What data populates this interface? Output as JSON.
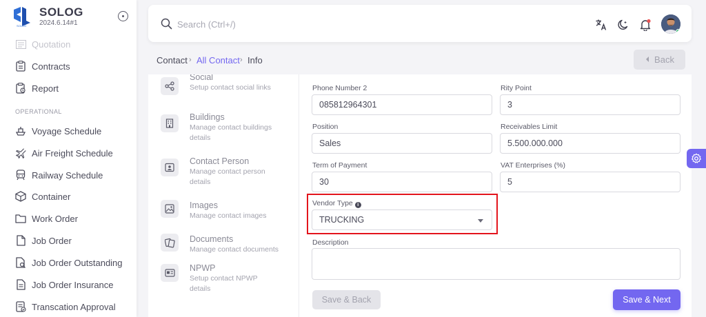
{
  "brand": {
    "name": "SOLOG",
    "version": "2024.6.14#1",
    "logo_text": "SL"
  },
  "sidebar": {
    "section_label": "OPERATIONAL",
    "items": [
      {
        "label": "Quotation",
        "icon": "quotation-icon"
      },
      {
        "label": "Contracts",
        "icon": "contract-icon"
      },
      {
        "label": "Report",
        "icon": "report-icon"
      },
      {
        "label": "Voyage Schedule",
        "icon": "ship-icon"
      },
      {
        "label": "Air Freight Schedule",
        "icon": "plane-icon"
      },
      {
        "label": "Railway Schedule",
        "icon": "train-icon"
      },
      {
        "label": "Container",
        "icon": "container-icon"
      },
      {
        "label": "Work Order",
        "icon": "folder-icon"
      },
      {
        "label": "Job Order",
        "icon": "file-icon"
      },
      {
        "label": "Job Order Outstanding",
        "icon": "file-search-icon"
      },
      {
        "label": "Job Order Insurance",
        "icon": "file-text-icon"
      },
      {
        "label": "Transcation Approval",
        "icon": "approval-icon"
      }
    ]
  },
  "topbar": {
    "search_placeholder": "Search (Ctrl+/)"
  },
  "breadcrumb": {
    "items": [
      "Contact",
      "All Contact",
      "Info"
    ],
    "back_label": "Back"
  },
  "contact_menu": [
    {
      "title": "Social",
      "desc": "Setup contact social links",
      "icon": "share-icon"
    },
    {
      "title": "Buildings",
      "desc": "Manage contact buildings details",
      "icon": "building-icon"
    },
    {
      "title": "Contact Person",
      "desc": "Manage contact person details",
      "icon": "person-icon"
    },
    {
      "title": "Images",
      "desc": "Manage contact images",
      "icon": "image-icon"
    },
    {
      "title": "Documents",
      "desc": "Manage contact documents",
      "icon": "documents-icon"
    },
    {
      "title": "NPWP",
      "desc": "Setup contact NPWP details",
      "icon": "id-card-icon"
    }
  ],
  "form": {
    "phone2": {
      "label": "Phone Number 2",
      "value": "085812964301"
    },
    "rity_point": {
      "label": "Rity Point",
      "value": "3"
    },
    "position": {
      "label": "Position",
      "value": "Sales"
    },
    "receivables_limit": {
      "label": "Receivables Limit",
      "value": "5.500.000.000"
    },
    "term_of_payment": {
      "label": "Term of Payment",
      "value": "30"
    },
    "vat_enterprises": {
      "label": "VAT Enterprises (%)",
      "value": "5"
    },
    "vendor_type": {
      "label": "Vendor Type",
      "value": "TRUCKING"
    },
    "description": {
      "label": "Description",
      "value": ""
    }
  },
  "actions": {
    "save_back": "Save & Back",
    "save_next": "Save & Next"
  },
  "colors": {
    "primary": "#7367f0",
    "highlight": "#e3141c",
    "brand_blue": "#2f6fd6"
  }
}
